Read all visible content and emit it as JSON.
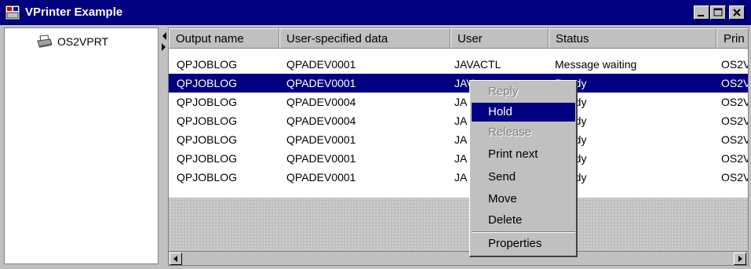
{
  "window": {
    "title": "VPrinter Example"
  },
  "tree": {
    "items": [
      {
        "label": "OS2VPRT"
      }
    ]
  },
  "table": {
    "columns": [
      "Output name",
      "User-specified data",
      "User",
      "Status",
      "Prin"
    ],
    "rows": [
      [
        "QPJOBLOG",
        "QPADEV0001",
        "JAVACTL",
        "Message waiting",
        "OS2V"
      ],
      [
        "QPJOBLOG",
        "QPADEV0001",
        "JAV",
        "Ready",
        "OS2V"
      ],
      [
        "QPJOBLOG",
        "QPADEV0004",
        "JA",
        "Ready",
        "OS2V"
      ],
      [
        "QPJOBLOG",
        "QPADEV0004",
        "JA",
        "Ready",
        "OS2V"
      ],
      [
        "QPJOBLOG",
        "QPADEV0001",
        "JA",
        "Ready",
        "OS2V"
      ],
      [
        "QPJOBLOG",
        "QPADEV0001",
        "JA",
        "Ready",
        "OS2V"
      ],
      [
        "QPJOBLOG",
        "QPADEV0001",
        "JA",
        "Ready",
        "OS2V"
      ]
    ],
    "selected_row": 1
  },
  "context_menu": {
    "items": [
      {
        "label": "Reply",
        "enabled": false
      },
      {
        "label": "Hold",
        "enabled": true,
        "highlighted": true
      },
      {
        "label": "Release",
        "enabled": false
      },
      {
        "label": "Print next",
        "enabled": true
      },
      {
        "label": "Send",
        "enabled": true
      },
      {
        "label": "Move",
        "enabled": true
      },
      {
        "label": "Delete",
        "enabled": true
      },
      {
        "label": "Properties",
        "enabled": true
      }
    ]
  },
  "colors": {
    "titlebar": "#000080",
    "selection": "#000080",
    "face": "#c0c0c0"
  },
  "icons": [
    "app-icon",
    "printer-icon",
    "minimize-icon",
    "maximize-icon",
    "close-icon",
    "scroll-left-icon",
    "scroll-right-icon"
  ]
}
